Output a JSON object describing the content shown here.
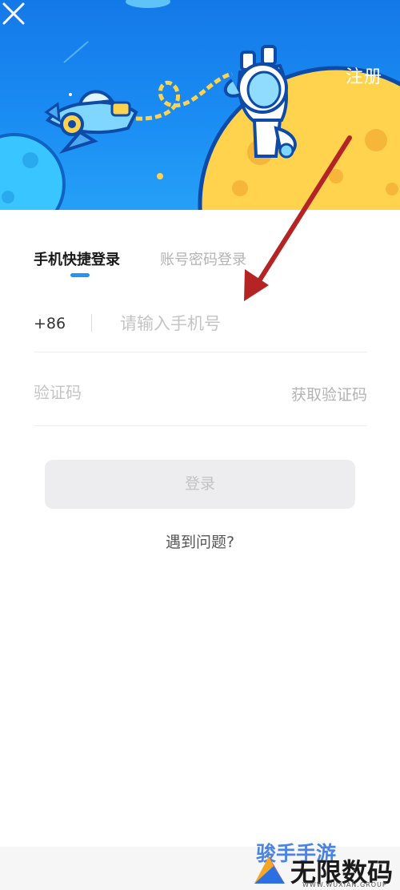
{
  "header": {
    "register_label": "注册",
    "close_icon": "close-icon",
    "colors": {
      "sky": "#1a8cf3",
      "moon": "#ffd34e"
    }
  },
  "tabs": [
    {
      "label": "手机快捷登录",
      "active": true
    },
    {
      "label": "账号密码登录",
      "active": false
    }
  ],
  "form": {
    "country_code": "+86",
    "phone_placeholder": "请输入手机号",
    "phone_value": "",
    "code_placeholder": "验证码",
    "code_value": "",
    "get_code_label": "获取验证码",
    "login_label": "登录",
    "help_label": "遇到问题?"
  },
  "accent_color": "#2196f3",
  "watermark": {
    "top_text": "骏手手游",
    "main_text": "无限数码",
    "sub_text": "WWW.WUXIAN.GROUP"
  }
}
